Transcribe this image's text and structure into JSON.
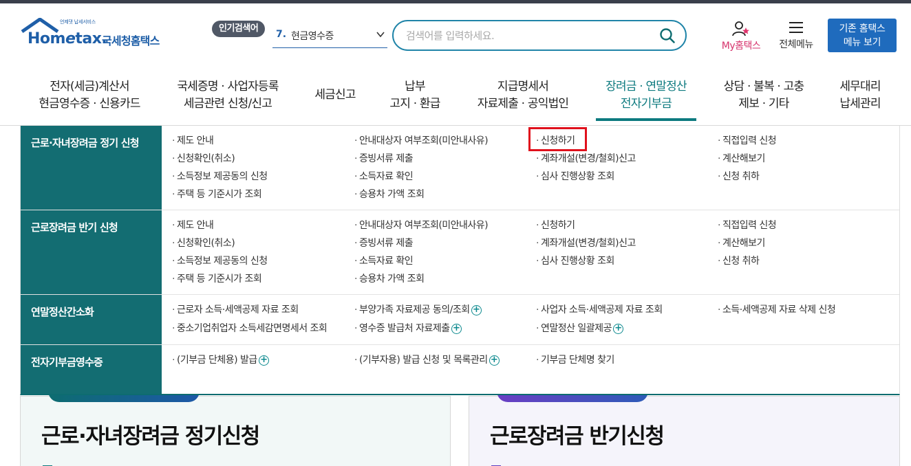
{
  "header": {
    "logo_tagline": "언제댓 납세서비스",
    "logo_brand_pre": "Hom",
    "logo_brand_e": "e",
    "logo_brand_post": "tax.",
    "logo_name": "국세청홈택스",
    "popular_label": "인기검색어",
    "popular_rank": "7.",
    "popular_term": "현금영수증",
    "search_placeholder": "검색어를 입력하세요.",
    "my_hometax": "My홈택스",
    "all_menu": "전체메뉴",
    "old_home_line1": "기존 홈택스",
    "old_home_line2": "메뉴 보기"
  },
  "gnb": [
    {
      "line1": "전자(세금)계산서",
      "line2": "현금영수증 · 신용카드"
    },
    {
      "line1": "국세증명 · 사업자등록",
      "line2": "세금관련 신청/신고"
    },
    {
      "line1": "세금신고",
      "line2": ""
    },
    {
      "line1": "납부",
      "line2": "고지 · 환급"
    },
    {
      "line1": "지급명세서",
      "line2": "자료제출 · 공익법인"
    },
    {
      "line1": "장려금 · 연말정산",
      "line2": "전자기부금"
    },
    {
      "line1": "상담 · 불복 · 고충",
      "line2": "제보 · 기타"
    },
    {
      "line1": "세무대리",
      "line2": "납세관리"
    }
  ],
  "mega": {
    "rows": [
      {
        "title": "근로·자녀장려금 정기 신청",
        "items": [
          "제도 안내",
          "안내대상자 여부조회(미안내사유)",
          "신청하기",
          "직접입력 신청",
          "신청확인(취소)",
          "증빙서류 제출",
          "계좌개설(변경/철회)신고",
          "계산해보기",
          "소득정보 제공동의 신청",
          "소득자료 확인",
          "심사 진행상황 조회",
          "신청 취하",
          "주택 등 기준시가 조회",
          "승용차 가액 조회"
        ]
      },
      {
        "title": "근로장려금 반기 신청",
        "items": [
          "제도 안내",
          "안내대상자 여부조회(미안내사유)",
          "신청하기",
          "직접입력 신청",
          "신청확인(취소)",
          "증빙서류 제출",
          "계좌개설(변경/철회)신고",
          "계산해보기",
          "소득정보 제공동의 신청",
          "소득자료 확인",
          "심사 진행상황 조회",
          "신청 취하",
          "주택 등 기준시가 조회",
          "승용차 가액 조회"
        ]
      },
      {
        "title": "연말정산간소화",
        "items": [
          "근로자 소득·세액공제 자료 조회",
          "부양가족 자료제공 동의/조회",
          "사업자 소득·세액공제 자료 조회",
          "소득·세액공제 자료 삭제 신청",
          "중소기업취업자 소득세감면명세서 조회",
          "영수증 발급처 자료제출",
          "연말정산 일괄제공"
        ]
      },
      {
        "title": "전자기부금영수증",
        "items": [
          "(기부금 단체용) 발급",
          "(기부자용) 발급 신청 및 목록관리",
          "기부금 단체명 찾기"
        ]
      }
    ]
  },
  "cards": {
    "left_title": "근로·자녀장려금 정기신청",
    "right_title": "근로장려금 반기신청"
  },
  "colors": {
    "accent_teal": "#0d7a7f",
    "side_panel": "#136d72",
    "brand_blue": "#1f5fa8",
    "highlight_red": "#e0101c"
  }
}
